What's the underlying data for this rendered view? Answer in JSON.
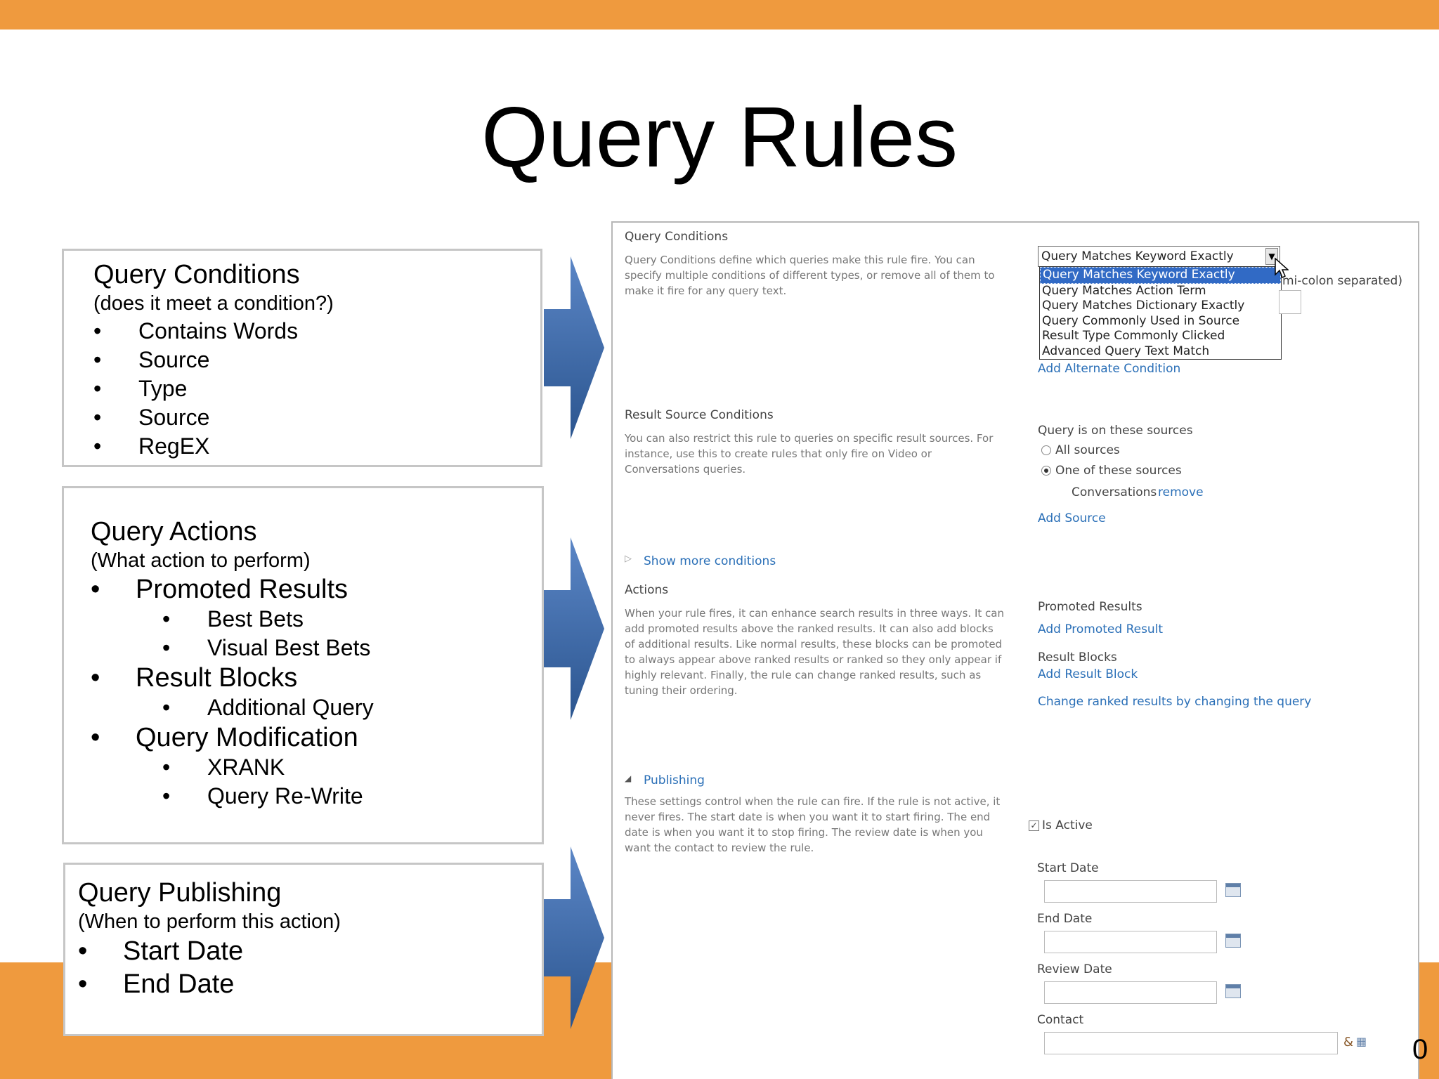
{
  "slide": {
    "title": "Query Rules",
    "page_number": "0"
  },
  "colors": {
    "accent": "#ef9a3e",
    "arrow": "#3a66a8",
    "link": "#2a6fb7"
  },
  "boxes": {
    "conditions": {
      "heading": "Query Conditions",
      "subheading": "(does it meet a condition?)",
      "items": [
        "Contains Words",
        "Source",
        "Type",
        "Source",
        "RegEX"
      ]
    },
    "actions": {
      "heading": "Query Actions",
      "subheading": "(What action to perform)",
      "items": [
        {
          "label": "Promoted Results",
          "children": [
            "Best Bets",
            "Visual Best Bets"
          ]
        },
        {
          "label": "Result Blocks",
          "children": [
            "Additional Query"
          ]
        },
        {
          "label": "Query Modification",
          "children": [
            "XRANK",
            "Query Re-Write"
          ]
        }
      ]
    },
    "publishing": {
      "heading": "Query Publishing",
      "subheading": "(When to perform this action)",
      "items": [
        "Start Date",
        "End Date"
      ]
    }
  },
  "screenshot": {
    "query_conditions": {
      "title": "Query Conditions",
      "description": "Query Conditions define which queries make this rule fire. You can specify multiple conditions of different types, or remove all of them to make it fire for any query text.",
      "dropdown_value": "Query Matches Keyword Exactly",
      "dropdown_options": [
        "Query Matches Keyword Exactly",
        "Query Matches Action Term",
        "Query Matches Dictionary Exactly",
        "Query Commonly Used in Source",
        "Result Type Commonly Clicked",
        "Advanced Query Text Match"
      ],
      "hint_partial": "mi-colon separated)",
      "add_condition": "Add Alternate Condition"
    },
    "result_source": {
      "title": "Result Source Conditions",
      "description": "You can also restrict this rule to queries on specific result sources. For instance, use this to create rules that only fire on Video or Conversations queries.",
      "label": "Query is on these sources",
      "option_all": "All sources",
      "option_one": "One of these sources",
      "source_name": "Conversations",
      "remove": "remove",
      "add_source": "Add Source"
    },
    "show_more": "Show more conditions",
    "actions": {
      "title": "Actions",
      "description": "When your rule fires, it can enhance search results in three ways. It can add promoted results above the ranked results. It can also add blocks of additional results. Like normal results, these blocks can be promoted to always appear above ranked results or ranked so they only appear if highly relevant. Finally, the rule can change ranked results, such as tuning their ordering.",
      "promoted_label": "Promoted Results",
      "add_promoted": "Add Promoted Result",
      "blocks_label": "Result Blocks",
      "add_block": "Add Result Block",
      "change_ranked": "Change ranked results by changing the query"
    },
    "publishing": {
      "title": "Publishing",
      "description": "These settings control when the rule can fire. If the rule is not active, it never fires. The start date is when you want it to start firing. The end date is when you want it to stop firing. The review date is when you want the contact to review the rule.",
      "is_active": "Is Active",
      "start_date": "Start Date",
      "end_date": "End Date",
      "review_date": "Review Date",
      "contact": "Contact"
    }
  }
}
